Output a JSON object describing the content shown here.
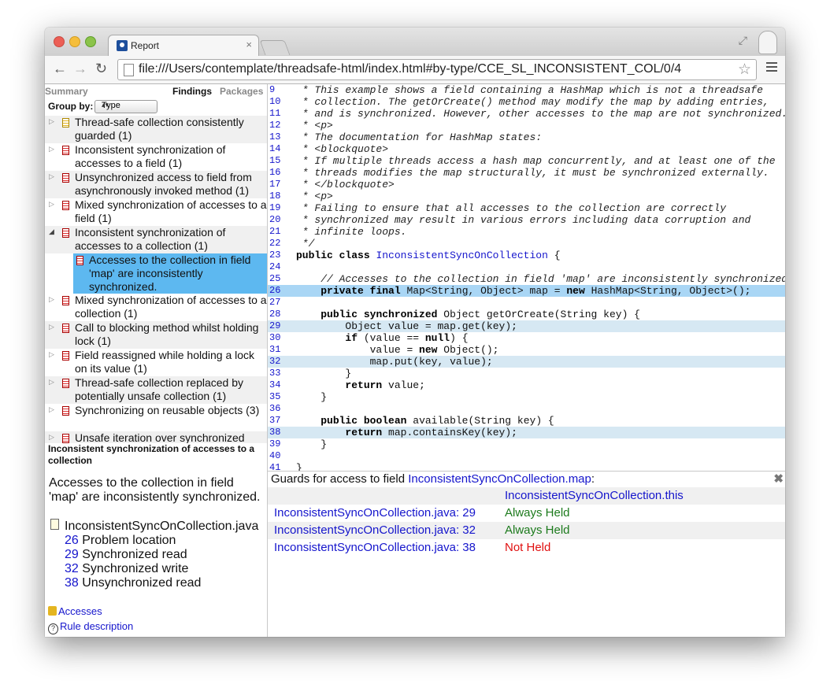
{
  "window": {
    "tab_title": "Report",
    "tab_close": "×",
    "url": "file:///Users/contemplate/threadsafe-html/index.html#by-type/CCE_SL_INCONSISTENT_COL/0/4"
  },
  "nav": {
    "summary": "Summary",
    "findings": "Findings",
    "packages": "Packages"
  },
  "groupby": {
    "label": "Group by:",
    "value": "Type"
  },
  "tree": [
    {
      "label": "Thread-safe collection consistently guarded (1)",
      "icon": "yellow-finding-icon"
    },
    {
      "label": "Inconsistent synchronization of accesses to a field (1)",
      "icon": "red-finding-icon"
    },
    {
      "label": "Unsynchronized access to field from asynchronously invoked method (1)",
      "icon": "red-finding-icon"
    },
    {
      "label": "Mixed synchronization of accesses to a field (1)",
      "icon": "red-finding-icon"
    },
    {
      "label": "Inconsistent synchronization of accesses to a collection (1)",
      "icon": "red-finding-icon",
      "expanded": true
    },
    {
      "label": "Accesses to the collection in field 'map' are inconsistently synchronized.",
      "icon": "red-finding-icon",
      "selected": true
    },
    {
      "label": "Mixed synchronization of accesses to a collection (1)",
      "icon": "red-finding-icon"
    },
    {
      "label": "Call to blocking method whilst holding lock (1)",
      "icon": "red-finding-icon"
    },
    {
      "label": "Field reassigned while holding a lock on its value (1)",
      "icon": "red-finding-icon"
    },
    {
      "label": "Thread-safe collection replaced by potentially unsafe collection (1)",
      "icon": "red-finding-icon"
    },
    {
      "label": "Synchronizing on reusable objects (3)",
      "icon": "red-finding-icon"
    },
    {
      "label": "Unsafe iteration over synchronized",
      "icon": "red-finding-icon"
    }
  ],
  "detail": {
    "title": "Inconsistent synchronization of accesses to a collection",
    "description": "Accesses to the collection in field 'map' are inconsistently synchronized.",
    "file": "InconsistentSyncOnCollection.java",
    "locations": [
      {
        "line": "26",
        "text": "Problem location"
      },
      {
        "line": "29",
        "text": "Synchronized read"
      },
      {
        "line": "32",
        "text": "Synchronized write"
      },
      {
        "line": "38",
        "text": "Unsynchronized read"
      }
    ],
    "links": {
      "accesses": "Accesses",
      "rule": "Rule description"
    }
  },
  "code": {
    "lines": [
      {
        "n": "9",
        "t": " * This example shows a field containing a HashMap which is not a threadsafe"
      },
      {
        "n": "10",
        "t": " * collection. The getOrCreate() method may modify the map by adding entries,"
      },
      {
        "n": "11",
        "t": " * and is synchronized. However, other accesses to the map are not synchronized."
      },
      {
        "n": "12",
        "t": " * <p>"
      },
      {
        "n": "13",
        "t": " * The documentation for HashMap states:"
      },
      {
        "n": "14",
        "t": " * <blockquote>"
      },
      {
        "n": "15",
        "t": " * If multiple threads access a hash map concurrently, and at least one of the"
      },
      {
        "n": "16",
        "t": " * threads modifies the map structurally, it must be synchronized externally."
      },
      {
        "n": "17",
        "t": " * </blockquote>"
      },
      {
        "n": "18",
        "t": " * <p>"
      },
      {
        "n": "19",
        "t": " * Failing to ensure that all accesses to the collection are correctly"
      },
      {
        "n": "20",
        "t": " * synchronized may result in various errors including data corruption and"
      },
      {
        "n": "21",
        "t": " * infinite loops."
      },
      {
        "n": "22",
        "t": " */"
      },
      {
        "n": "23",
        "t": "public class InconsistentSyncOnCollection {"
      },
      {
        "n": "24",
        "t": ""
      },
      {
        "n": "25",
        "t": "    // Accesses to the collection in field 'map' are inconsistently synchronized."
      },
      {
        "n": "26",
        "t": "    private final Map<String, Object> map = new HashMap<String, Object>();"
      },
      {
        "n": "27",
        "t": ""
      },
      {
        "n": "28",
        "t": "    public synchronized Object getOrCreate(String key) {"
      },
      {
        "n": "29",
        "t": "        Object value = map.get(key);"
      },
      {
        "n": "30",
        "t": "        if (value == null) {"
      },
      {
        "n": "31",
        "t": "            value = new Object();"
      },
      {
        "n": "32",
        "t": "            map.put(key, value);"
      },
      {
        "n": "33",
        "t": "        }"
      },
      {
        "n": "34",
        "t": "        return value;"
      },
      {
        "n": "35",
        "t": "    }"
      },
      {
        "n": "36",
        "t": ""
      },
      {
        "n": "37",
        "t": "    public boolean available(String key) {"
      },
      {
        "n": "38",
        "t": "        return map.containsKey(key);"
      },
      {
        "n": "39",
        "t": "    }"
      },
      {
        "n": "40",
        "t": ""
      },
      {
        "n": "41",
        "t": "}"
      }
    ],
    "highlight_primary": [
      "26"
    ],
    "highlight_secondary": [
      "29",
      "32",
      "38"
    ]
  },
  "guards": {
    "heading_prefix": "Guards for access to field ",
    "field": "InconsistentSyncOnCollection.map",
    "heading_suffix": ":",
    "close": "✖",
    "lock_header": "InconsistentSyncOnCollection.this",
    "rows": [
      {
        "location": "InconsistentSyncOnCollection.java: 29",
        "status": "Always Held",
        "color": "#1c7a1c"
      },
      {
        "location": "InconsistentSyncOnCollection.java: 32",
        "status": "Always Held",
        "color": "#1c7a1c"
      },
      {
        "location": "InconsistentSyncOnCollection.java: 38",
        "status": "Not Held",
        "color": "#e01010"
      }
    ]
  },
  "colors": {
    "selection": "#5db8f0",
    "link": "#1515cc",
    "code_highlight": "#d6e8f3"
  }
}
